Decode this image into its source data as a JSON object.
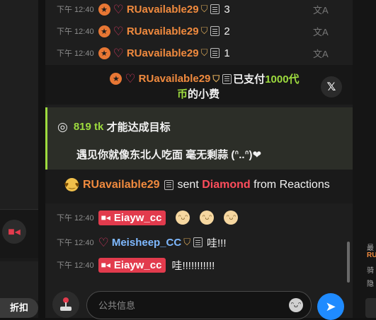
{
  "messages_top": [
    {
      "time": "下午 12:40",
      "username": "RUavailable29",
      "count": "3"
    },
    {
      "time": "下午 12:40",
      "username": "RUavailable29",
      "count": "2"
    },
    {
      "time": "下午 12:40",
      "username": "RUavailable29",
      "count": "1"
    }
  ],
  "tip": {
    "username": "RUavailable29",
    "text_before": "已支付",
    "amount": "1000代",
    "amount_line2": "币",
    "text_after": "的小费"
  },
  "goal": {
    "amount": "819 tk",
    "text": "才能达成目标",
    "description": "遇见你就像东北人吃面 毫无剩蒜 (ᐢ..ᐢ)❤"
  },
  "gift": {
    "username": "RUavailable29",
    "sent": "sent",
    "item": "Diamond",
    "from_text": "from Reactions"
  },
  "chat_messages": [
    {
      "time": "下午 12:40",
      "username": "Eiayw_cc"
    },
    {
      "time": "下午 12:40",
      "username": "Meisheep_CC",
      "text": "哇!!!"
    },
    {
      "time": "下午 12:40",
      "username": "Eiayw_cc",
      "text": "哇!!!!!!!!!!!"
    }
  ],
  "input": {
    "placeholder": "公共信息"
  },
  "left": {
    "discount_label": "折扣"
  },
  "right_panel": {
    "line1": "最",
    "line2": "RU",
    "line3": "骑",
    "line4": "隐"
  },
  "colors": {
    "accent_green": "#9ddb3e",
    "host_red": "#e23b4d",
    "username_orange": "#f08a3e",
    "send_blue": "#1f8bff"
  },
  "icons": [
    "star-icon",
    "diamond-icon",
    "shield-icon",
    "document-icon",
    "translate-icon",
    "x-logo-icon",
    "target-icon",
    "heart-eyes-emoji",
    "camera-icon",
    "smile-emoji",
    "joystick-icon",
    "emoji-icon",
    "send-icon"
  ]
}
